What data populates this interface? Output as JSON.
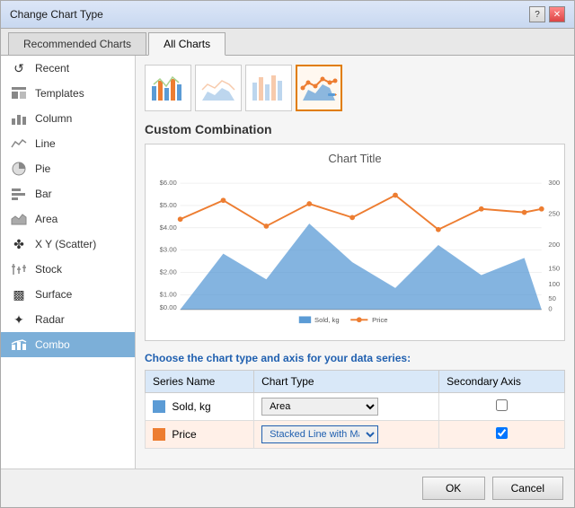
{
  "dialog": {
    "title": "Change Chart Type",
    "tabs": [
      {
        "id": "recommended",
        "label": "Recommended Charts",
        "active": false
      },
      {
        "id": "all",
        "label": "All Charts",
        "active": true
      }
    ]
  },
  "sidebar": {
    "items": [
      {
        "id": "recent",
        "label": "Recent",
        "icon": "↺"
      },
      {
        "id": "templates",
        "label": "Templates",
        "icon": "📋"
      },
      {
        "id": "column",
        "label": "Column",
        "icon": "▦"
      },
      {
        "id": "line",
        "label": "Line",
        "icon": "〜"
      },
      {
        "id": "pie",
        "label": "Pie",
        "icon": "◑"
      },
      {
        "id": "bar",
        "label": "Bar",
        "icon": "≡"
      },
      {
        "id": "area",
        "label": "Area",
        "icon": "◺"
      },
      {
        "id": "xy",
        "label": "X Y (Scatter)",
        "icon": "✤"
      },
      {
        "id": "stock",
        "label": "Stock",
        "icon": "📈"
      },
      {
        "id": "surface",
        "label": "Surface",
        "icon": "▩"
      },
      {
        "id": "radar",
        "label": "Radar",
        "icon": "✦"
      },
      {
        "id": "combo",
        "label": "Combo",
        "icon": "⫶",
        "active": true
      }
    ]
  },
  "main": {
    "section_title": "Custom Combination",
    "chart_title": "Chart Title",
    "series_prompt": "Choose the chart type and axis for your data series:",
    "columns": {
      "series_name": "Series Name",
      "chart_type": "Chart Type",
      "secondary_axis": "Secondary Axis"
    },
    "series": [
      {
        "name": "Sold, kg",
        "color": "#5b9bd5",
        "chart_type": "Area",
        "secondary_axis": false
      },
      {
        "name": "Price",
        "color": "#ed7d31",
        "chart_type": "Stacked Line with Ma...",
        "secondary_axis": true
      }
    ]
  },
  "footer": {
    "ok_label": "OK",
    "cancel_label": "Cancel"
  },
  "icons": {
    "help": "?",
    "close": "✕"
  }
}
